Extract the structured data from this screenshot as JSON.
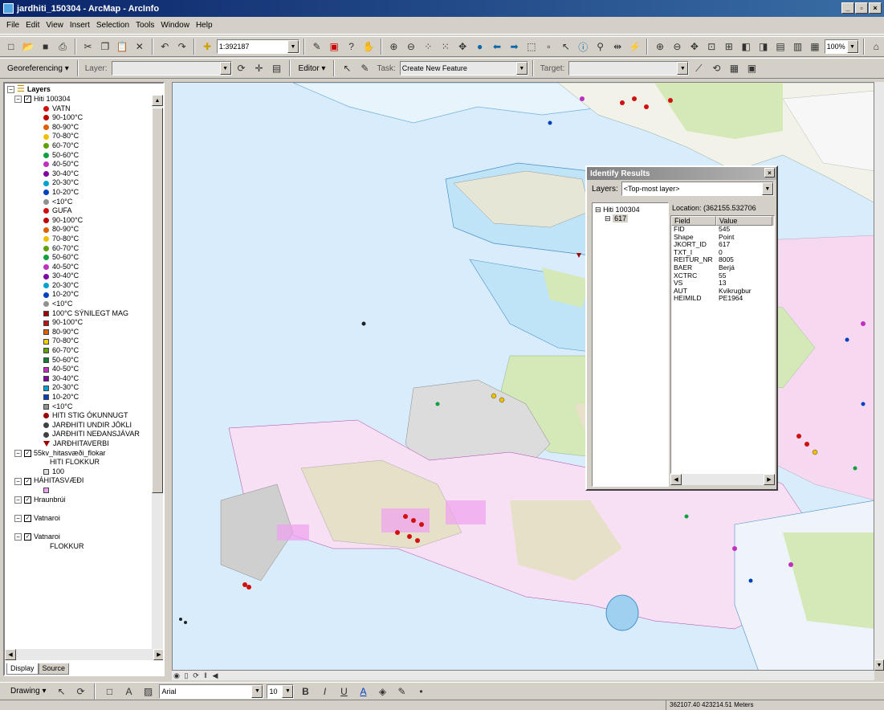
{
  "window": {
    "title": "jardhiti_150304 - ArcMap - ArcInfo",
    "min": "_",
    "max": "▫",
    "close": "×"
  },
  "menu": [
    "File",
    "Edit",
    "View",
    "Insert",
    "Selection",
    "Tools",
    "Window",
    "Help"
  ],
  "toolbar1": {
    "scale": "1:392187",
    "zoom": "100%"
  },
  "toolbar2": {
    "georeferencing": "Georeferencing ▾",
    "layer_label": "Layer:",
    "editor": "Editor ▾",
    "task_label": "Task:",
    "task_value": "Create New Feature",
    "target_label": "Target:"
  },
  "toc": {
    "root": "Layers",
    "items": [
      {
        "text": "Hiti 100304",
        "kind": "group",
        "color": ""
      },
      {
        "text": "VATN",
        "kind": "sym",
        "color": "#d01010"
      },
      {
        "text": "90-100°C",
        "kind": "sym",
        "color": "#c00000"
      },
      {
        "text": "80-90°C",
        "kind": "sym",
        "color": "#e06000"
      },
      {
        "text": "70-80°C",
        "kind": "sym",
        "color": "#f0c000"
      },
      {
        "text": "60-70°C",
        "kind": "sym",
        "color": "#60a000"
      },
      {
        "text": "50-60°C",
        "kind": "sym",
        "color": "#10a040"
      },
      {
        "text": "40-50°C",
        "kind": "sym",
        "color": "#c030c0"
      },
      {
        "text": "30-40°C",
        "kind": "sym",
        "color": "#8000a0"
      },
      {
        "text": "20-30°C",
        "kind": "sym",
        "color": "#00a0d0"
      },
      {
        "text": "10-20°C",
        "kind": "sym",
        "color": "#0040c0"
      },
      {
        "text": "<10°C",
        "kind": "sym",
        "color": "#909090"
      },
      {
        "text": "GUFA",
        "kind": "sym",
        "color": "#d01010"
      },
      {
        "text": "90-100°C",
        "kind": "sym",
        "color": "#c00000"
      },
      {
        "text": "80-90°C",
        "kind": "sym",
        "color": "#e06000"
      },
      {
        "text": "70-80°C",
        "kind": "sym",
        "color": "#f0c000"
      },
      {
        "text": "60-70°C",
        "kind": "sym",
        "color": "#60a000"
      },
      {
        "text": "50-60°C",
        "kind": "sym",
        "color": "#10a040"
      },
      {
        "text": "40-50°C",
        "kind": "sym",
        "color": "#c030c0"
      },
      {
        "text": "30-40°C",
        "kind": "sym",
        "color": "#8000a0"
      },
      {
        "text": "20-30°C",
        "kind": "sym",
        "color": "#00a0d0"
      },
      {
        "text": "10-20°C",
        "kind": "sym",
        "color": "#0040c0"
      },
      {
        "text": "<10°C",
        "kind": "sym",
        "color": "#909090"
      },
      {
        "text": "100°C SÝNILEGT MAG",
        "kind": "sq",
        "color": "#a00000"
      },
      {
        "text": "90-100°C",
        "kind": "sq",
        "color": "#c01010"
      },
      {
        "text": "80-90°C",
        "kind": "sq",
        "color": "#e06000"
      },
      {
        "text": "70-80°C",
        "kind": "sq",
        "color": "#f0d000"
      },
      {
        "text": "60-70°C",
        "kind": "sq",
        "color": "#60a000"
      },
      {
        "text": "50-60°C",
        "kind": "sq",
        "color": "#108030"
      },
      {
        "text": "40-50°C",
        "kind": "sq",
        "color": "#c030c0"
      },
      {
        "text": "30-40°C",
        "kind": "sq",
        "color": "#8000a0"
      },
      {
        "text": "20-30°C",
        "kind": "sq",
        "color": "#00a0d0"
      },
      {
        "text": "10-20°C",
        "kind": "sq",
        "color": "#0040c0"
      },
      {
        "text": "<10°C",
        "kind": "sq",
        "color": "#909090"
      },
      {
        "text": "HITI STIG ÓKUNNUGT",
        "kind": "sym",
        "color": "#a00000"
      },
      {
        "text": "JARÐHITI UNDIR JÖKLI",
        "kind": "sym",
        "color": "#404040"
      },
      {
        "text": "JARÐHITI NEÐANSJÁVAR",
        "kind": "sym",
        "color": "#404040"
      },
      {
        "text": "JARÐHITAVERBI",
        "kind": "tri",
        "color": "#a00000"
      },
      {
        "text": "55kv_hitasvæði_flokar",
        "kind": "group",
        "color": ""
      },
      {
        "text": "HITI FLOKKUR",
        "kind": "plain",
        "color": ""
      },
      {
        "text": "100",
        "kind": "sq",
        "color": "#e0e0e0"
      },
      {
        "text": "HÁHITASVÆÐI",
        "kind": "group",
        "color": ""
      },
      {
        "text": "",
        "kind": "sq",
        "color": "#f0a0f0"
      },
      {
        "text": "Hraunbrúi",
        "kind": "group",
        "color": ""
      },
      {
        "text": "",
        "kind": "plain",
        "color": ""
      },
      {
        "text": "Vatnaroi",
        "kind": "group",
        "color": ""
      },
      {
        "text": "",
        "kind": "plain",
        "color": ""
      },
      {
        "text": "Vatnaroi",
        "kind": "group",
        "color": ""
      },
      {
        "text": "FLOKKUR",
        "kind": "plain",
        "color": ""
      }
    ],
    "tabs": [
      "Display",
      "Source"
    ]
  },
  "identify": {
    "title": "Identify Results",
    "layers_label": "Layers:",
    "layers_value": "<Top-most layer>",
    "tree_root": "Hiti 100304",
    "tree_child": "617",
    "location": "Location: (362155.532706",
    "field_header": "Field",
    "value_header": "Value",
    "rows": [
      {
        "field": "FID",
        "value": "545"
      },
      {
        "field": "Shape",
        "value": "Point"
      },
      {
        "field": "JKORT_ID",
        "value": "617"
      },
      {
        "field": "TXT_I",
        "value": "0"
      },
      {
        "field": "REITUR_NR",
        "value": "8005"
      },
      {
        "field": "BAER",
        "value": "Berjá"
      },
      {
        "field": "XCTRC",
        "value": "55"
      },
      {
        "field": "VS",
        "value": "13"
      },
      {
        "field": "AUT",
        "value": "Kvikrugbur"
      },
      {
        "field": "HEIMILD",
        "value": "PE1964"
      }
    ]
  },
  "drawing": {
    "label": "Drawing ▾",
    "font": "Arial",
    "size": "10"
  },
  "status": {
    "coords": "362107.40  423214.51 Meters"
  }
}
